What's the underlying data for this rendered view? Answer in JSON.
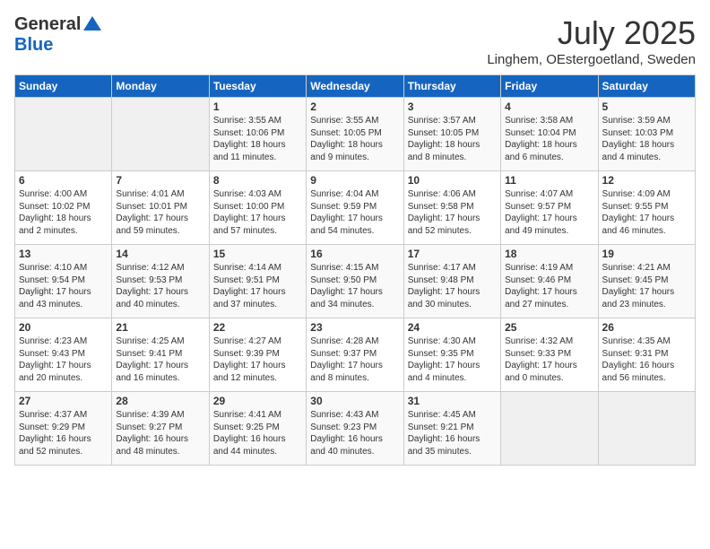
{
  "logo": {
    "general": "General",
    "blue": "Blue"
  },
  "title": "July 2025",
  "location": "Linghem, OEstergoetland, Sweden",
  "headers": [
    "Sunday",
    "Monday",
    "Tuesday",
    "Wednesday",
    "Thursday",
    "Friday",
    "Saturday"
  ],
  "weeks": [
    [
      {
        "day": "",
        "content": ""
      },
      {
        "day": "",
        "content": ""
      },
      {
        "day": "1",
        "content": "Sunrise: 3:55 AM\nSunset: 10:06 PM\nDaylight: 18 hours\nand 11 minutes."
      },
      {
        "day": "2",
        "content": "Sunrise: 3:55 AM\nSunset: 10:05 PM\nDaylight: 18 hours\nand 9 minutes."
      },
      {
        "day": "3",
        "content": "Sunrise: 3:57 AM\nSunset: 10:05 PM\nDaylight: 18 hours\nand 8 minutes."
      },
      {
        "day": "4",
        "content": "Sunrise: 3:58 AM\nSunset: 10:04 PM\nDaylight: 18 hours\nand 6 minutes."
      },
      {
        "day": "5",
        "content": "Sunrise: 3:59 AM\nSunset: 10:03 PM\nDaylight: 18 hours\nand 4 minutes."
      }
    ],
    [
      {
        "day": "6",
        "content": "Sunrise: 4:00 AM\nSunset: 10:02 PM\nDaylight: 18 hours\nand 2 minutes."
      },
      {
        "day": "7",
        "content": "Sunrise: 4:01 AM\nSunset: 10:01 PM\nDaylight: 17 hours\nand 59 minutes."
      },
      {
        "day": "8",
        "content": "Sunrise: 4:03 AM\nSunset: 10:00 PM\nDaylight: 17 hours\nand 57 minutes."
      },
      {
        "day": "9",
        "content": "Sunrise: 4:04 AM\nSunset: 9:59 PM\nDaylight: 17 hours\nand 54 minutes."
      },
      {
        "day": "10",
        "content": "Sunrise: 4:06 AM\nSunset: 9:58 PM\nDaylight: 17 hours\nand 52 minutes."
      },
      {
        "day": "11",
        "content": "Sunrise: 4:07 AM\nSunset: 9:57 PM\nDaylight: 17 hours\nand 49 minutes."
      },
      {
        "day": "12",
        "content": "Sunrise: 4:09 AM\nSunset: 9:55 PM\nDaylight: 17 hours\nand 46 minutes."
      }
    ],
    [
      {
        "day": "13",
        "content": "Sunrise: 4:10 AM\nSunset: 9:54 PM\nDaylight: 17 hours\nand 43 minutes."
      },
      {
        "day": "14",
        "content": "Sunrise: 4:12 AM\nSunset: 9:53 PM\nDaylight: 17 hours\nand 40 minutes."
      },
      {
        "day": "15",
        "content": "Sunrise: 4:14 AM\nSunset: 9:51 PM\nDaylight: 17 hours\nand 37 minutes."
      },
      {
        "day": "16",
        "content": "Sunrise: 4:15 AM\nSunset: 9:50 PM\nDaylight: 17 hours\nand 34 minutes."
      },
      {
        "day": "17",
        "content": "Sunrise: 4:17 AM\nSunset: 9:48 PM\nDaylight: 17 hours\nand 30 minutes."
      },
      {
        "day": "18",
        "content": "Sunrise: 4:19 AM\nSunset: 9:46 PM\nDaylight: 17 hours\nand 27 minutes."
      },
      {
        "day": "19",
        "content": "Sunrise: 4:21 AM\nSunset: 9:45 PM\nDaylight: 17 hours\nand 23 minutes."
      }
    ],
    [
      {
        "day": "20",
        "content": "Sunrise: 4:23 AM\nSunset: 9:43 PM\nDaylight: 17 hours\nand 20 minutes."
      },
      {
        "day": "21",
        "content": "Sunrise: 4:25 AM\nSunset: 9:41 PM\nDaylight: 17 hours\nand 16 minutes."
      },
      {
        "day": "22",
        "content": "Sunrise: 4:27 AM\nSunset: 9:39 PM\nDaylight: 17 hours\nand 12 minutes."
      },
      {
        "day": "23",
        "content": "Sunrise: 4:28 AM\nSunset: 9:37 PM\nDaylight: 17 hours\nand 8 minutes."
      },
      {
        "day": "24",
        "content": "Sunrise: 4:30 AM\nSunset: 9:35 PM\nDaylight: 17 hours\nand 4 minutes."
      },
      {
        "day": "25",
        "content": "Sunrise: 4:32 AM\nSunset: 9:33 PM\nDaylight: 17 hours\nand 0 minutes."
      },
      {
        "day": "26",
        "content": "Sunrise: 4:35 AM\nSunset: 9:31 PM\nDaylight: 16 hours\nand 56 minutes."
      }
    ],
    [
      {
        "day": "27",
        "content": "Sunrise: 4:37 AM\nSunset: 9:29 PM\nDaylight: 16 hours\nand 52 minutes."
      },
      {
        "day": "28",
        "content": "Sunrise: 4:39 AM\nSunset: 9:27 PM\nDaylight: 16 hours\nand 48 minutes."
      },
      {
        "day": "29",
        "content": "Sunrise: 4:41 AM\nSunset: 9:25 PM\nDaylight: 16 hours\nand 44 minutes."
      },
      {
        "day": "30",
        "content": "Sunrise: 4:43 AM\nSunset: 9:23 PM\nDaylight: 16 hours\nand 40 minutes."
      },
      {
        "day": "31",
        "content": "Sunrise: 4:45 AM\nSunset: 9:21 PM\nDaylight: 16 hours\nand 35 minutes."
      },
      {
        "day": "",
        "content": ""
      },
      {
        "day": "",
        "content": ""
      }
    ]
  ]
}
